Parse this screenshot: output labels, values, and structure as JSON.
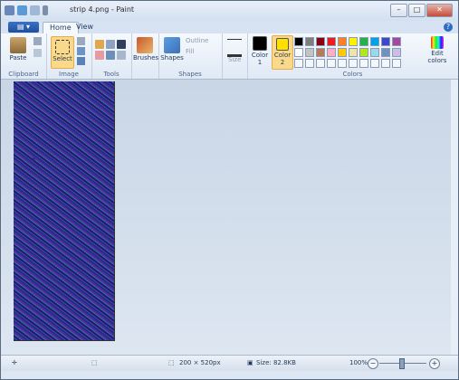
{
  "window": {
    "title": "strip 4.png - Paint"
  },
  "tabs": {
    "home": "Home",
    "view": "View"
  },
  "groups": {
    "clipboard": {
      "label": "Clipboard",
      "paste": "Paste"
    },
    "image": {
      "label": "Image",
      "select": "Select"
    },
    "tools": {
      "label": "Tools"
    },
    "brushes": {
      "label": "Brushes"
    },
    "shapes": {
      "label": "Shapes",
      "shapes_btn": "Shapes",
      "outline": "Outline",
      "fill": "Fill"
    },
    "size": {
      "label": "Size"
    },
    "colors": {
      "label": "Colors",
      "color1": "Color 1",
      "color2": "Color 2",
      "edit": "Edit colors",
      "color1_value": "#000000",
      "color2_value": "#ffe000",
      "palette_row1": [
        "#000000",
        "#7f7f7f",
        "#880015",
        "#ed1c24",
        "#ff7f27",
        "#fff200",
        "#22b14c",
        "#00a2e8",
        "#3f48cc",
        "#a349a4"
      ],
      "palette_row2": [
        "#ffffff",
        "#c3c3c3",
        "#b97a57",
        "#ffaec9",
        "#ffc90e",
        "#efe4b0",
        "#b5e61d",
        "#99d9ea",
        "#7092be",
        "#c8bfe7"
      ]
    }
  },
  "status": {
    "dimensions": "200 × 520px",
    "size": "Size: 82.8KB",
    "zoom": "100%"
  }
}
